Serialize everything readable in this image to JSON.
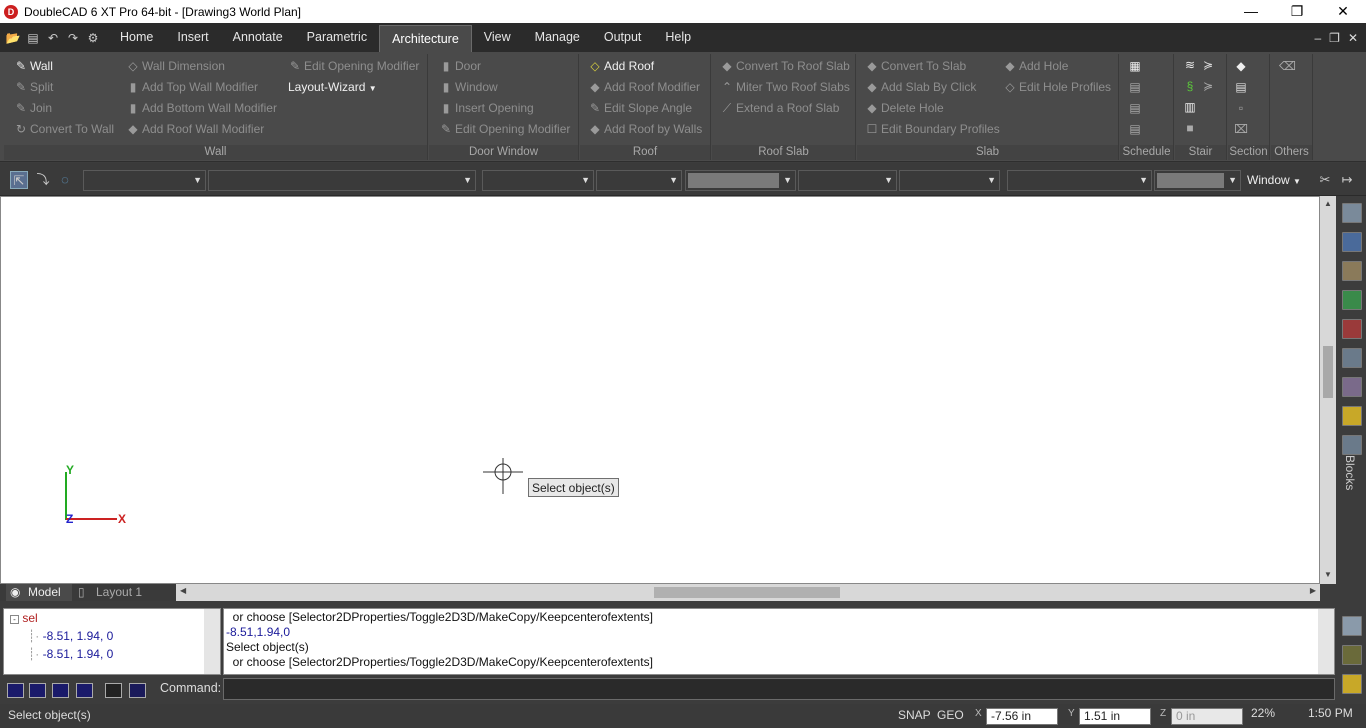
{
  "window": {
    "title": "DoubleCAD 6 XT Pro 64-bit - [Drawing3 World Plan]",
    "logo_letter": "D",
    "controls": [
      "—",
      "❐",
      "✕"
    ]
  },
  "menu": {
    "tabs": [
      "Home",
      "Insert",
      "Annotate",
      "Parametric",
      "Architecture",
      "View",
      "Manage",
      "Output",
      "Help"
    ],
    "active": "Architecture"
  },
  "ribbon": {
    "wall": {
      "label": "Wall",
      "items": [
        "Wall",
        "Split",
        "Join",
        "Convert To Wall",
        "Wall Dimension",
        "Add Top Wall Modifier",
        "Add Bottom Wall Modifier",
        "Add Roof Wall Modifier",
        "Edit Opening Modifier",
        "Layout-Wizard"
      ]
    },
    "door_window": {
      "label": "Door Window",
      "items": [
        "Door",
        "Window",
        "Insert Opening",
        "Edit Opening Modifier"
      ]
    },
    "roof": {
      "label": "Roof",
      "items": [
        "Add Roof",
        "Add Roof Modifier",
        "Edit Slope Angle",
        "Add Roof by Walls"
      ]
    },
    "roof_slab": {
      "label": "Roof Slab",
      "items": [
        "Convert To Roof Slab",
        "Miter Two Roof Slabs",
        "Extend a Roof Slab"
      ]
    },
    "slab": {
      "label": "Slab",
      "items": [
        "Convert To Slab",
        "Add Slab By Click",
        "Delete Hole",
        "Edit Boundary Profiles",
        "Add Hole",
        "Edit Hole Profiles"
      ]
    },
    "small_groups": [
      "Schedule",
      "Stair",
      "Section",
      "Others"
    ]
  },
  "toolbar": {
    "window_label": "Window"
  },
  "canvas": {
    "tooltip": "Select object(s)",
    "ucs_y": "Y",
    "ucs_x": "X",
    "ucs_z": "Z"
  },
  "right_panel": {
    "blocks_label": "Blocks"
  },
  "layout_tabs": [
    "Model",
    "Layout 1"
  ],
  "tree": {
    "root": "sel",
    "children": [
      "-8.51, 1.94, 0",
      "-8.51, 1.94, 0"
    ]
  },
  "history": [
    "  or choose [Selector2DProperties/Toggle2D3D/MakeCopy/Keepcenterofextents]",
    "-8.51,1.94,0",
    "Select object(s)",
    "  or choose [Selector2DProperties/Toggle2D3D/MakeCopy/Keepcenterofextents]"
  ],
  "command": {
    "label": "Command:",
    "value": ""
  },
  "status": {
    "prompt": "Select object(s)",
    "snap": "SNAP",
    "geo": "GEO",
    "x": "-7.56 in",
    "y": "1.51 in",
    "z": "0 in",
    "zoom": "22%",
    "time": "1:50 PM",
    "x_axis": "X",
    "y_axis": "Y",
    "z_axis": "Z"
  },
  "colors": {
    "ucs_x": "#cc2222",
    "ucs_y": "#22aa22",
    "ucs_z": "#2222cc",
    "ribbon_bg": "#4a4a4a",
    "app_red": "#cc1f1f"
  }
}
